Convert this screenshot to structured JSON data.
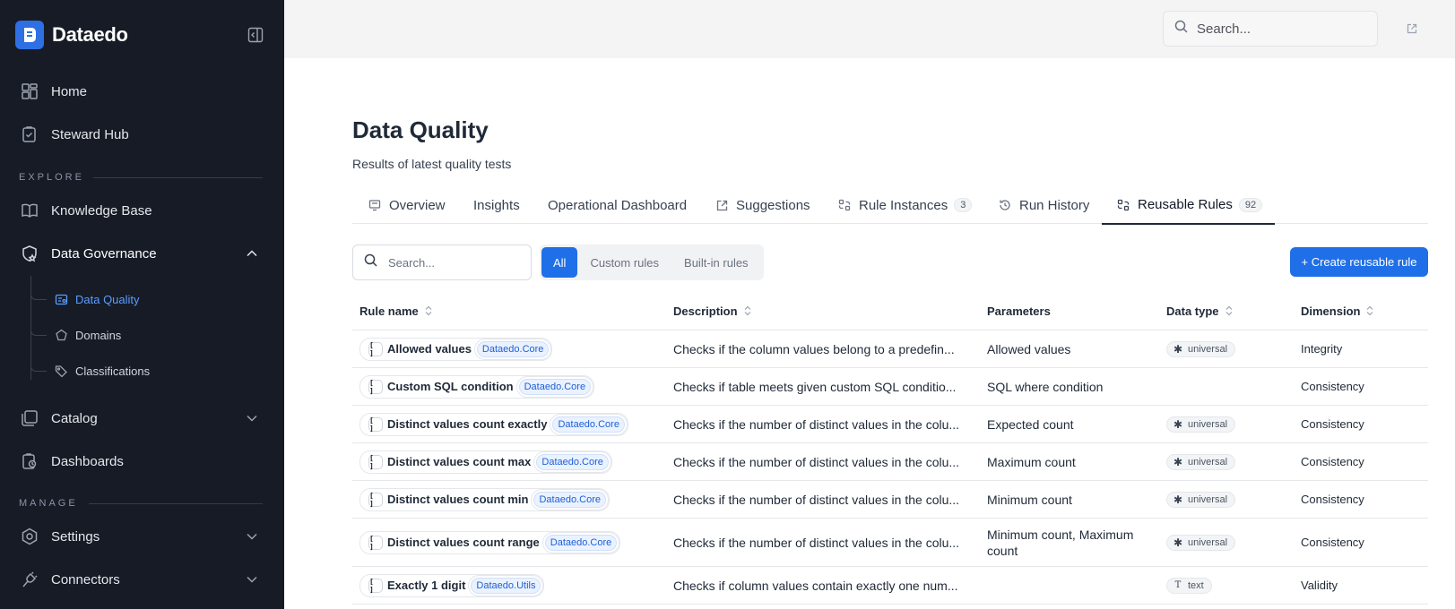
{
  "app": {
    "name": "Dataedo"
  },
  "sidebar": {
    "items": [
      {
        "label": "Home",
        "icon": "home-icon"
      },
      {
        "label": "Steward Hub",
        "icon": "clipboard-icon"
      }
    ],
    "section_explore": "EXPLORE",
    "explore_items": [
      {
        "label": "Knowledge Base",
        "icon": "book-icon"
      },
      {
        "label": "Data Governance",
        "icon": "shield-icon",
        "expanded": true
      }
    ],
    "governance_sub": [
      {
        "label": "Data Quality",
        "active": true
      },
      {
        "label": "Domains"
      },
      {
        "label": "Classifications"
      }
    ],
    "catalog": {
      "label": "Catalog"
    },
    "dashboards": {
      "label": "Dashboards"
    },
    "section_manage": "MANAGE",
    "settings": {
      "label": "Settings"
    },
    "connectors": {
      "label": "Connectors"
    }
  },
  "topbar": {
    "search_placeholder": "Search..."
  },
  "page": {
    "title": "Data Quality",
    "subtitle": "Results of latest quality tests"
  },
  "tabs": [
    {
      "label": "Overview"
    },
    {
      "label": "Insights"
    },
    {
      "label": "Operational Dashboard"
    },
    {
      "label": "Suggestions"
    },
    {
      "label": "Rule Instances",
      "count": "3"
    },
    {
      "label": "Run History"
    },
    {
      "label": "Reusable Rules",
      "count": "92",
      "active": true
    }
  ],
  "toolbar": {
    "search_placeholder": "Search...",
    "filters": [
      "All",
      "Custom rules",
      "Built-in rules"
    ],
    "create_label": "+ Create reusable rule"
  },
  "table": {
    "columns": [
      "Rule name",
      "Description",
      "Parameters",
      "Data type",
      "Dimension"
    ],
    "rows": [
      {
        "name": "Allowed values",
        "ns": "Dataedo.Core",
        "description": "Checks if the column values belong to a predefin...",
        "params": "Allowed values",
        "dtype": "universal",
        "dimension": "Integrity"
      },
      {
        "name": "Custom SQL condition",
        "ns": "Dataedo.Core",
        "description": "Checks if table meets given custom SQL conditio...",
        "params": "SQL where condition",
        "dtype": "",
        "dimension": "Consistency"
      },
      {
        "name": "Distinct values count exactly",
        "ns": "Dataedo.Core",
        "description": "Checks if the number of distinct values in the colu...",
        "params": "Expected count",
        "dtype": "universal",
        "dimension": "Consistency"
      },
      {
        "name": "Distinct values count max",
        "ns": "Dataedo.Core",
        "description": "Checks if the number of distinct values in the colu...",
        "params": "Maximum count",
        "dtype": "universal",
        "dimension": "Consistency"
      },
      {
        "name": "Distinct values count min",
        "ns": "Dataedo.Core",
        "description": "Checks if the number of distinct values in the colu...",
        "params": "Minimum count",
        "dtype": "universal",
        "dimension": "Consistency"
      },
      {
        "name": "Distinct values count range",
        "ns": "Dataedo.Core",
        "description": "Checks if the number of distinct values in the colu...",
        "params": "Minimum count, Maximum count",
        "dtype": "universal",
        "dimension": "Consistency"
      },
      {
        "name": "Exactly 1 digit",
        "ns": "Dataedo.Utils",
        "description": "Checks if column values contain exactly one num...",
        "params": "",
        "dtype": "text",
        "dimension": "Validity"
      }
    ]
  },
  "colors": {
    "accent": "#1f6fe8",
    "sidebar_bg": "#161b26",
    "active_sub": "#5b9cff"
  }
}
